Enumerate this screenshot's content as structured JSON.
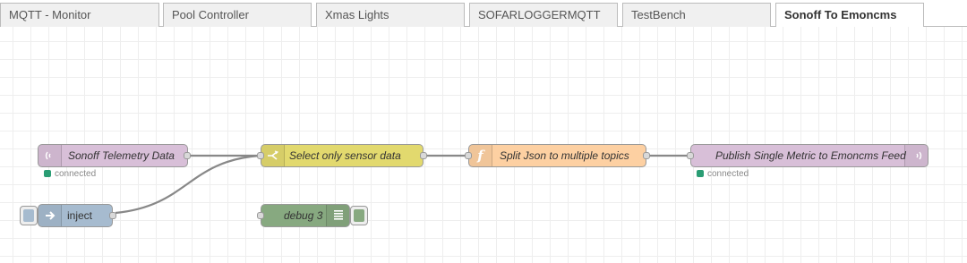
{
  "tabs": [
    {
      "label": "MQTT - Monitor",
      "active": false
    },
    {
      "label": "Pool Controller",
      "active": false
    },
    {
      "label": "Xmas Lights",
      "active": false
    },
    {
      "label": "SOFARLOGGERMQTT",
      "active": false
    },
    {
      "label": "TestBench",
      "active": false
    },
    {
      "label": "Sonoff To Emoncms",
      "active": true
    }
  ],
  "nodes": {
    "mqtt_in": {
      "label": "Sonoff Telemetry Data",
      "color": "#d8bfd8",
      "icon": "radio-waves-icon",
      "status": "connected"
    },
    "switch": {
      "label": "Select only sensor data",
      "color": "#e2d96e",
      "icon": "switch-icon"
    },
    "function": {
      "label": "Split Json to multiple topics",
      "color": "#fdd0a2",
      "icon": "function-icon"
    },
    "mqtt_out": {
      "label": "Publish Single Metric to Emoncms Feed",
      "color": "#d8bfd8",
      "icon": "radio-waves-icon",
      "status": "connected"
    },
    "inject": {
      "label": "inject",
      "color": "#a6bbcf",
      "icon": "arrow-right-icon"
    },
    "debug": {
      "label": "debug 3",
      "color": "#87a980",
      "icon": "list-icon"
    }
  },
  "colors": {
    "status_connected": "#2a9d74",
    "wire": "#888888"
  }
}
